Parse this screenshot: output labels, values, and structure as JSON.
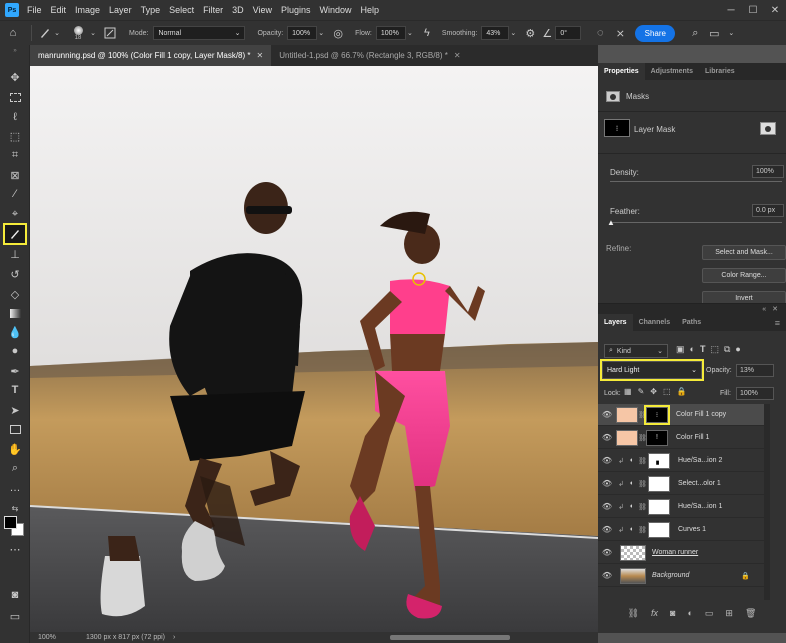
{
  "app": {
    "logo": "Ps"
  },
  "menu": [
    "File",
    "Edit",
    "Image",
    "Layer",
    "Type",
    "Select",
    "Filter",
    "3D",
    "View",
    "Plugins",
    "Window",
    "Help"
  ],
  "options_bar": {
    "brush_size": "18",
    "mode_label": "Mode:",
    "mode_value": "Normal",
    "opacity_label": "Opacity:",
    "opacity_value": "100%",
    "flow_label": "Flow:",
    "flow_value": "100%",
    "smoothing_label": "Smoothing:",
    "smoothing_value": "43%",
    "angle_value": "0°",
    "share_label": "Share"
  },
  "doc_tabs": [
    {
      "label": "manrunning.psd @ 100% (Color Fill 1 copy, Layer Mask/8) *",
      "active": true
    },
    {
      "label": "Untitled-1.psd @ 66.7% (Rectangle 3, RGB/8) *",
      "active": false
    }
  ],
  "status": {
    "zoom": "100%",
    "doc_info": "1300 px x 817 px (72 ppi)"
  },
  "properties": {
    "tabs": [
      "Properties",
      "Adjustments",
      "Libraries"
    ],
    "masks_label": "Masks",
    "layer_mask_label": "Layer Mask",
    "density_label": "Density:",
    "density_value": "100%",
    "feather_label": "Feather:",
    "feather_value": "0.0 px",
    "refine_label": "Refine:",
    "select_mask_btn": "Select and Mask...",
    "color_range_btn": "Color Range...",
    "invert_btn": "Invert"
  },
  "layers_panel": {
    "tabs": [
      "Layers",
      "Channels",
      "Paths"
    ],
    "filter_kind": "Kind",
    "blend_mode": "Hard Light",
    "opacity_label": "Opacity:",
    "opacity_value": "13%",
    "lock_label": "Lock:",
    "fill_label": "Fill:",
    "fill_value": "100%",
    "layers": [
      {
        "name": "Color Fill 1 copy",
        "selected": true,
        "thumb": "#f6c6a6"
      },
      {
        "name": "Color Fill 1",
        "selected": false,
        "thumb": "#f6c6a6"
      },
      {
        "name": "Hue/Sa...ion 2",
        "selected": false
      },
      {
        "name": "Select...olor 1",
        "selected": false
      },
      {
        "name": "Hue/Sa...ion 1",
        "selected": false
      },
      {
        "name": "Curves 1",
        "selected": false
      },
      {
        "name": "Woman runner",
        "selected": false
      },
      {
        "name": "Background",
        "selected": false
      }
    ]
  },
  "colors": {
    "accent": "#1473e6",
    "highlight": "#f5eb3a",
    "panel_bg": "#323232"
  }
}
